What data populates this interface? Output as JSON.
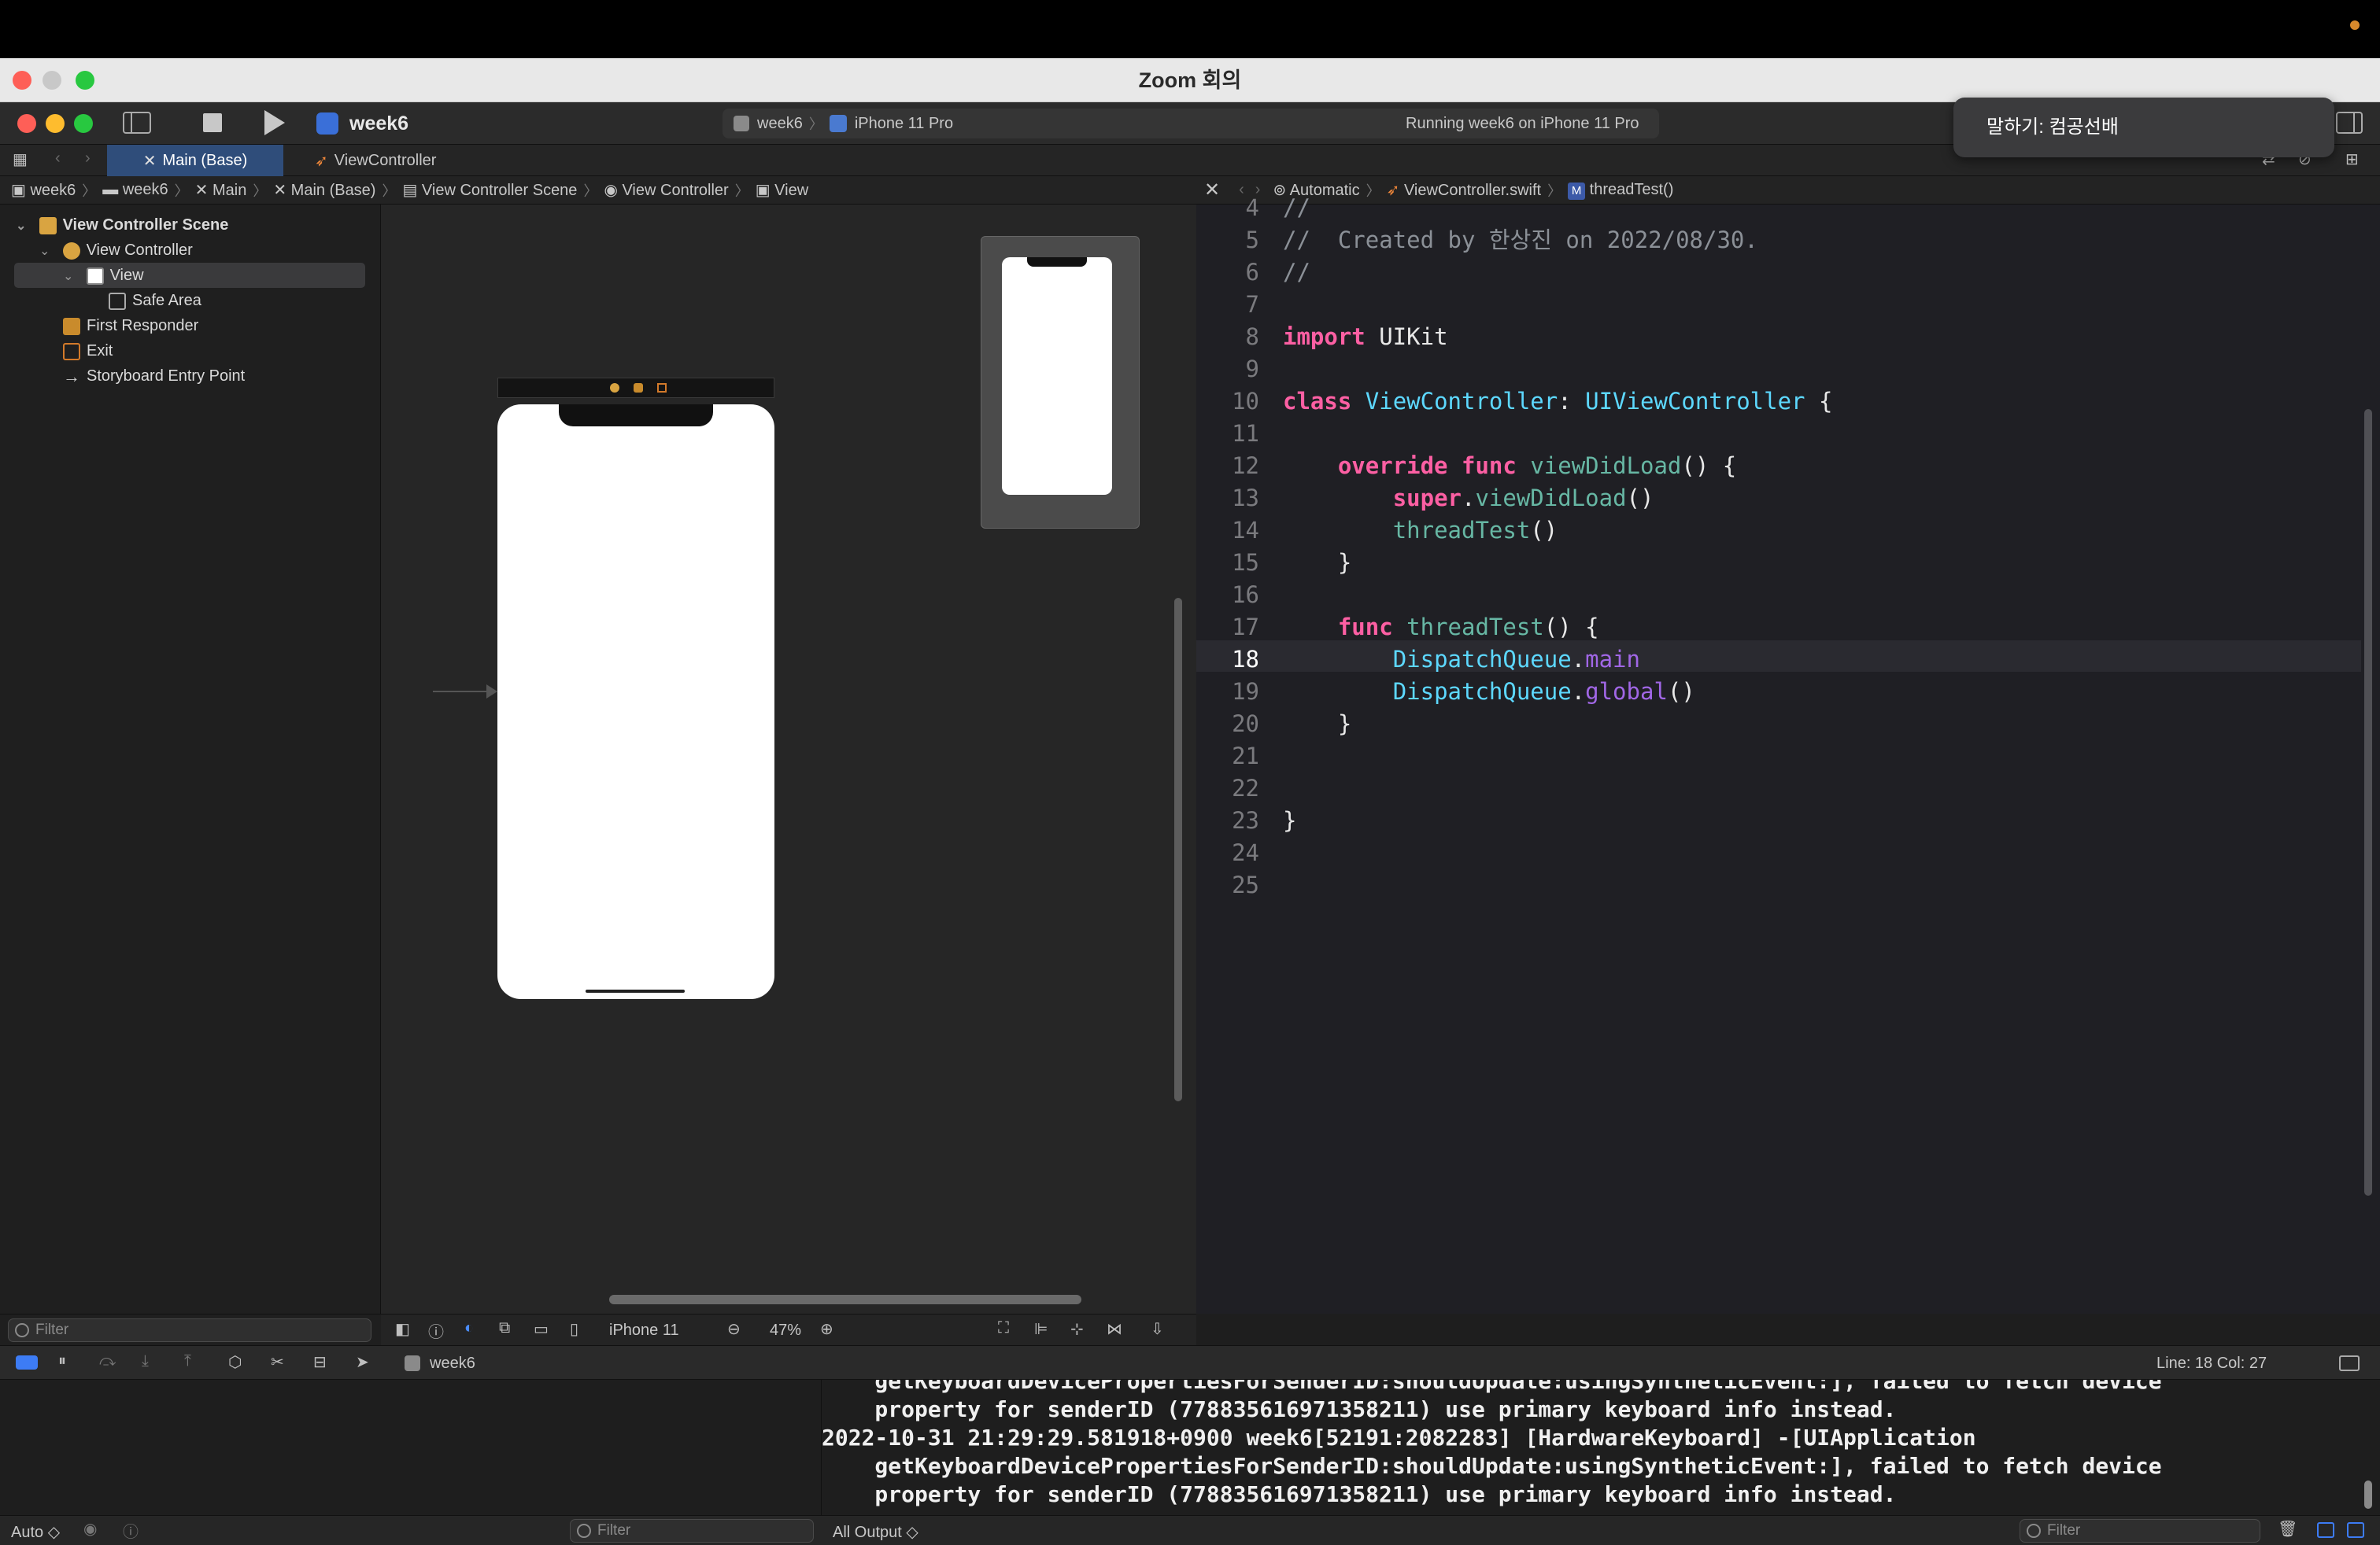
{
  "zoom": {
    "title": "Zoom 회의",
    "toast": "말하기: 컴공선배"
  },
  "toolbar": {
    "scheme": "week6",
    "dest_scheme": "week6",
    "dest_device": "iPhone 11 Pro",
    "status": "Running week6 on iPhone 11 Pro"
  },
  "tabs": [
    {
      "label": "Main (Base)",
      "active": true
    },
    {
      "label": "ViewController",
      "active": false
    }
  ],
  "jump_left": [
    "week6",
    "week6",
    "Main",
    "Main (Base)",
    "View Controller Scene",
    "View Controller",
    "View"
  ],
  "jump_right": [
    "Automatic",
    "ViewController.swift",
    "threadTest()"
  ],
  "navigator": {
    "items": [
      {
        "label": "View Controller Scene",
        "level": 0,
        "bold": true
      },
      {
        "label": "View Controller",
        "level": 1
      },
      {
        "label": "View",
        "level": 2,
        "selected": true
      },
      {
        "label": "Safe Area",
        "level": 3
      },
      {
        "label": "First Responder",
        "level": 1
      },
      {
        "label": "Exit",
        "level": 1
      },
      {
        "label": "Storyboard Entry Point",
        "level": 1
      }
    ],
    "filter_placeholder": "Filter"
  },
  "canvas_bar": {
    "device": "iPhone 11",
    "zoom": "47%"
  },
  "editor": {
    "current_line": 18,
    "lines": [
      {
        "n": "4",
        "text": "//"
      },
      {
        "n": "5",
        "text": "//  Created by 한상진 on 2022/08/30."
      },
      {
        "n": "6",
        "text": "//"
      },
      {
        "n": "7",
        "text": ""
      },
      {
        "n": "8",
        "text": "import UIKit"
      },
      {
        "n": "9",
        "text": ""
      },
      {
        "n": "10",
        "text": "class ViewController: UIViewController {"
      },
      {
        "n": "11",
        "text": ""
      },
      {
        "n": "12",
        "text": "    override func viewDidLoad() {"
      },
      {
        "n": "13",
        "text": "        super.viewDidLoad()"
      },
      {
        "n": "14",
        "text": "        threadTest()"
      },
      {
        "n": "15",
        "text": "    }"
      },
      {
        "n": "16",
        "text": ""
      },
      {
        "n": "17",
        "text": "    func threadTest() {"
      },
      {
        "n": "18",
        "text": "        DispatchQueue.main"
      },
      {
        "n": "19",
        "text": "        DispatchQueue.global()"
      },
      {
        "n": "20",
        "text": "    }"
      },
      {
        "n": "21",
        "text": ""
      },
      {
        "n": "22",
        "text": ""
      },
      {
        "n": "23",
        "text": "}"
      },
      {
        "n": "24",
        "text": ""
      },
      {
        "n": "25",
        "text": ""
      }
    ]
  },
  "debug": {
    "process": "week6",
    "line_col": "Line: 18  Col: 27"
  },
  "console": {
    "lines": [
      "    getKeyboardDevicePropertiesForSenderID:shouldUpdate:usingSyntheticEvent:], failed to fetch device",
      "    property for senderID (778835616971358211) use primary keyboard info instead.",
      "2022-10-31 21:29:29.581918+0900 week6[52191:2082283] [HardwareKeyboard] -[UIApplication",
      "    getKeyboardDevicePropertiesForSenderID:shouldUpdate:usingSyntheticEvent:], failed to fetch device",
      "    property for senderID (778835616971358211) use primary keyboard info instead."
    ]
  },
  "bottom": {
    "auto_label": "Auto ◇",
    "vars_filter": "Filter",
    "output_select": "All Output ◇",
    "console_filter": "Filter"
  }
}
